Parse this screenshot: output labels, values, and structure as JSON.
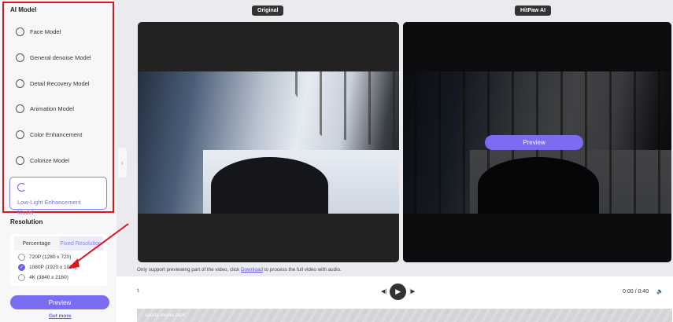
{
  "sidebar": {
    "section_title": "AI Model",
    "models": [
      {
        "label": "Face Model",
        "icon": "face-icon"
      },
      {
        "label": "General denoise Model",
        "icon": "denoise-icon"
      },
      {
        "label": "Detail Recovery Model",
        "icon": "detail-icon"
      },
      {
        "label": "Animation Model",
        "icon": "bear-icon"
      },
      {
        "label": "Color Enhancement",
        "icon": "sun-icon"
      },
      {
        "label": "Colorize Model",
        "icon": "palette-icon"
      },
      {
        "label": "Low-Light Enhancement Model",
        "icon": "moon-icon",
        "selected": true
      }
    ],
    "resolution_title": "Resolution",
    "tabs": [
      "Percentage",
      "Fixed Resolution"
    ],
    "options": [
      {
        "label": "720P (1280 x 720)",
        "checked": false
      },
      {
        "label": "1080P (1920 x 1080)",
        "checked": true
      },
      {
        "label": "4K (3840 x 2160)",
        "checked": false
      }
    ],
    "preview_label": "Preview",
    "get_more": "Get more"
  },
  "main": {
    "original_label": "Original",
    "ai_label": "HitPaw AI",
    "preview_label": "Preview",
    "note_before": "Only support previewing part of the video, click ",
    "note_link": "Download",
    "note_after": " to process the full video with audio.",
    "time": "0:00 / 0:40",
    "filename": "sports movie.mp4"
  },
  "colors": {
    "accent": "#7b6cf2",
    "highlight": "#e0141b"
  }
}
